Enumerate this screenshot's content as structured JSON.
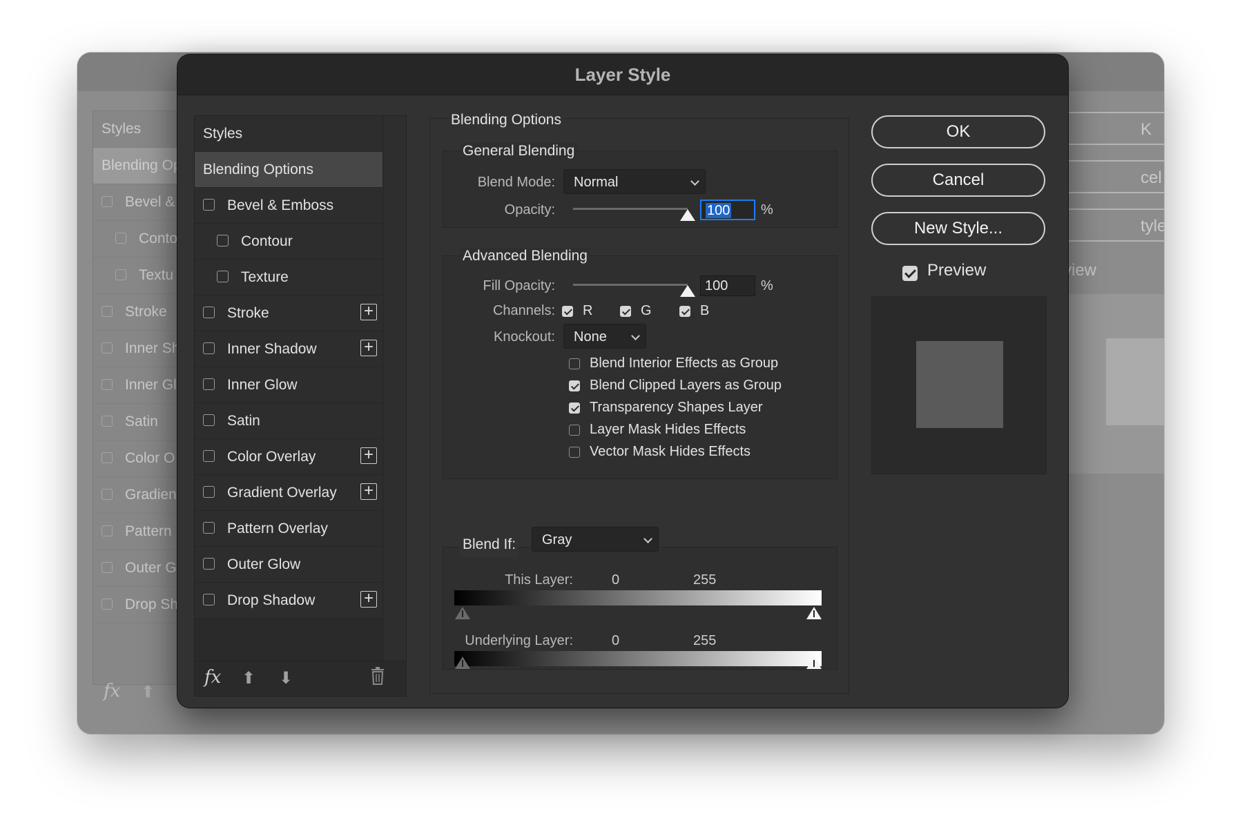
{
  "background_dialog": {
    "items": [
      {
        "label": "Styles",
        "checkbox": false,
        "selected": false,
        "indent": false
      },
      {
        "label": "Blending Op",
        "checkbox": false,
        "selected": true,
        "indent": false
      },
      {
        "label": "Bevel &",
        "checkbox": true,
        "selected": false,
        "indent": false
      },
      {
        "label": "Conto",
        "checkbox": true,
        "selected": false,
        "indent": true
      },
      {
        "label": "Textu",
        "checkbox": true,
        "selected": false,
        "indent": true
      },
      {
        "label": "Stroke",
        "checkbox": true,
        "selected": false,
        "indent": false
      },
      {
        "label": "Inner Sh",
        "checkbox": true,
        "selected": false,
        "indent": false
      },
      {
        "label": "Inner Gl",
        "checkbox": true,
        "selected": false,
        "indent": false
      },
      {
        "label": "Satin",
        "checkbox": true,
        "selected": false,
        "indent": false
      },
      {
        "label": "Color O",
        "checkbox": true,
        "selected": false,
        "indent": false
      },
      {
        "label": "Gradien",
        "checkbox": true,
        "selected": false,
        "indent": false
      },
      {
        "label": "Pattern",
        "checkbox": true,
        "selected": false,
        "indent": false
      },
      {
        "label": "Outer G",
        "checkbox": true,
        "selected": false,
        "indent": false
      },
      {
        "label": "Drop Sh",
        "checkbox": true,
        "selected": false,
        "indent": false
      }
    ],
    "buttons": [
      "K",
      "cel",
      "tyle..."
    ],
    "preview_label": "view",
    "fx_label": "fx"
  },
  "dialog": {
    "title": "Layer Style",
    "style_list": [
      {
        "label": "Styles",
        "checkbox": false,
        "selected": false,
        "indent": false,
        "plus": false
      },
      {
        "label": "Blending Options",
        "checkbox": false,
        "selected": true,
        "indent": false,
        "plus": false
      },
      {
        "label": "Bevel & Emboss",
        "checkbox": true,
        "selected": false,
        "indent": false,
        "plus": false
      },
      {
        "label": "Contour",
        "checkbox": true,
        "selected": false,
        "indent": true,
        "plus": false
      },
      {
        "label": "Texture",
        "checkbox": true,
        "selected": false,
        "indent": true,
        "plus": false
      },
      {
        "label": "Stroke",
        "checkbox": true,
        "selected": false,
        "indent": false,
        "plus": true
      },
      {
        "label": "Inner Shadow",
        "checkbox": true,
        "selected": false,
        "indent": false,
        "plus": true
      },
      {
        "label": "Inner Glow",
        "checkbox": true,
        "selected": false,
        "indent": false,
        "plus": false
      },
      {
        "label": "Satin",
        "checkbox": true,
        "selected": false,
        "indent": false,
        "plus": false
      },
      {
        "label": "Color Overlay",
        "checkbox": true,
        "selected": false,
        "indent": false,
        "plus": true
      },
      {
        "label": "Gradient Overlay",
        "checkbox": true,
        "selected": false,
        "indent": false,
        "plus": true
      },
      {
        "label": "Pattern Overlay",
        "checkbox": true,
        "selected": false,
        "indent": false,
        "plus": false
      },
      {
        "label": "Outer Glow",
        "checkbox": true,
        "selected": false,
        "indent": false,
        "plus": false
      },
      {
        "label": "Drop Shadow",
        "checkbox": true,
        "selected": false,
        "indent": false,
        "plus": true
      }
    ],
    "footer": {
      "fx": "fx"
    },
    "blending": {
      "heading": "Blending Options",
      "general": {
        "heading": "General Blending",
        "blend_mode_label": "Blend Mode:",
        "blend_mode_value": "Normal",
        "opacity_label": "Opacity:",
        "opacity_value": "100",
        "opacity_unit": "%",
        "opacity_level": 1.0
      },
      "advanced": {
        "heading": "Advanced Blending",
        "fill_opacity_label": "Fill Opacity:",
        "fill_opacity_value": "100",
        "fill_opacity_unit": "%",
        "fill_opacity_level": 1.0,
        "channels_label": "Channels:",
        "channels": [
          {
            "label": "R",
            "checked": true
          },
          {
            "label": "G",
            "checked": true
          },
          {
            "label": "B",
            "checked": true
          }
        ],
        "knockout_label": "Knockout:",
        "knockout_value": "None",
        "options": [
          {
            "label": "Blend Interior Effects as Group",
            "checked": false
          },
          {
            "label": "Blend Clipped Layers as Group",
            "checked": true
          },
          {
            "label": "Transparency Shapes Layer",
            "checked": true
          },
          {
            "label": "Layer Mask Hides Effects",
            "checked": false
          },
          {
            "label": "Vector Mask Hides Effects",
            "checked": false
          }
        ]
      },
      "blend_if": {
        "label": "Blend If:",
        "value": "Gray",
        "this_layer_label": "This Layer:",
        "this_layer_min": "0",
        "this_layer_max": "255",
        "underlying_label": "Underlying Layer:",
        "underlying_min": "0",
        "underlying_max": "255"
      }
    },
    "buttons": {
      "ok": "OK",
      "cancel": "Cancel",
      "new_style": "New Style..."
    },
    "preview": {
      "label": "Preview",
      "checked": true
    }
  }
}
